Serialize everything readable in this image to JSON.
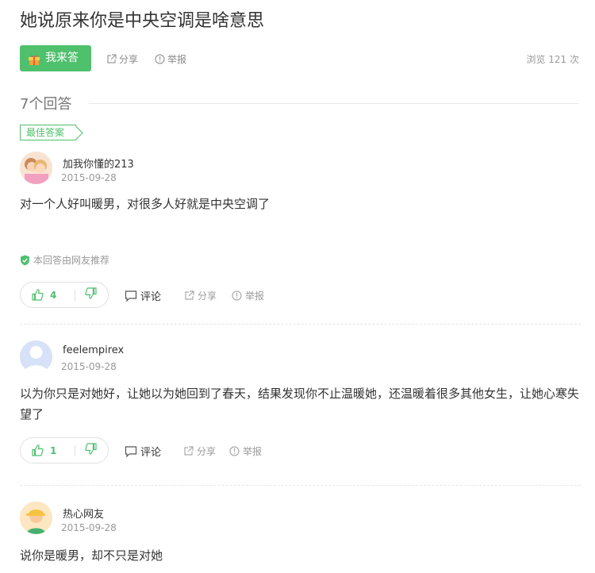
{
  "question": {
    "title": "她说原来你是中央空调是啥意思",
    "answer_button": "我来答",
    "share": "分享",
    "report": "举报",
    "views": "浏览 121 次"
  },
  "answers_header": {
    "count": "7个回答"
  },
  "best_tag": "最佳答案",
  "answers": [
    {
      "user": "加我你懂的213",
      "date": "2015-09-28",
      "content": "对一个人好叫暖男，对很多人好就是中央空调了",
      "recommend": "本回答由网友推荐",
      "likes": "4",
      "comment": "评论",
      "share": "分享",
      "report": "举报"
    },
    {
      "user": "feelempirex",
      "date": "2015-09-28",
      "content": "以为你只是对她好，让她以为她回到了春天，结果发现你不止温暖她，还温暖着很多其他女生，让她心寒失望了",
      "likes": "1",
      "comment": "评论",
      "share": "分享",
      "report": "举报"
    },
    {
      "user": "热心网友",
      "date": "2015-09-28",
      "content": "说你是暖男，却不只是对她"
    }
  ],
  "colors": {
    "accent": "#4fc06c",
    "muted": "#999999",
    "text": "#333333"
  },
  "icons": [
    "gift-icon",
    "share-icon",
    "report-icon",
    "shield-check-icon",
    "thumb-up-icon",
    "thumb-down-icon",
    "comment-icon",
    "avatar-placeholder-icon",
    "avatar-cap-icon"
  ]
}
